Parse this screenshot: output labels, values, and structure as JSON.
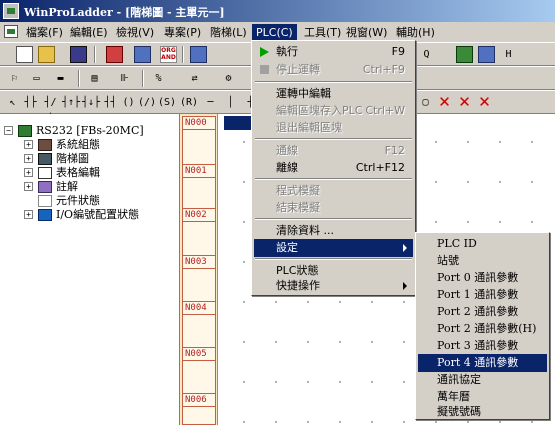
{
  "window": {
    "title": "WinProLadder - [階梯圖 - 主單元一]"
  },
  "menubar": {
    "items": [
      {
        "label": "檔案(F)"
      },
      {
        "label": "編輯(E)"
      },
      {
        "label": "檢視(V)"
      },
      {
        "label": "專案(P)"
      },
      {
        "label": "階梯(L)"
      },
      {
        "label": "PLC(C)"
      },
      {
        "label": "工具(T)"
      },
      {
        "label": "視窗(W)"
      },
      {
        "label": "輔助(H)"
      }
    ]
  },
  "toolbar": {
    "orand_label": "ORG AND"
  },
  "tree": {
    "root": {
      "label": "RS232 [FBs-20MC]"
    },
    "items": [
      {
        "label": "系統組態"
      },
      {
        "label": "階梯圖"
      },
      {
        "label": "表格編輯"
      },
      {
        "label": "註解"
      },
      {
        "label": "元件狀態"
      },
      {
        "label": "I/O編號配置狀態"
      }
    ]
  },
  "ladder": {
    "networks": [
      "N000",
      "N001",
      "N002",
      "N003",
      "N004",
      "N005",
      "N006"
    ]
  },
  "plc_menu": {
    "items": [
      {
        "label": "執行",
        "shortcut": "F9"
      },
      {
        "label": "停止運轉",
        "shortcut": "Ctrl+F9"
      },
      {
        "label": "運轉中編輯",
        "shortcut": ""
      },
      {
        "label": "編輯區塊存入PLC",
        "shortcut": "Ctrl+W"
      },
      {
        "label": "退出編輯區塊",
        "shortcut": ""
      },
      {
        "label": "通線",
        "shortcut": "F12"
      },
      {
        "label": "離線",
        "shortcut": "Ctrl+F12"
      },
      {
        "label": "程式模擬",
        "shortcut": ""
      },
      {
        "label": "結束模擬",
        "shortcut": ""
      },
      {
        "label": "清除資料 ...",
        "shortcut": ""
      },
      {
        "label": "設定",
        "shortcut": ""
      },
      {
        "label": "PLC狀態",
        "shortcut": ""
      },
      {
        "label": "快捷操作",
        "shortcut": ""
      }
    ]
  },
  "settings_submenu": {
    "items": [
      {
        "label": "PLC ID"
      },
      {
        "label": "站號"
      },
      {
        "label": "Port 0 通訊參數"
      },
      {
        "label": "Port 1 通訊參數"
      },
      {
        "label": "Port 2 通訊參數"
      },
      {
        "label": "Port 2 通訊參數(H)"
      },
      {
        "label": "Port 3 通訊參數"
      },
      {
        "label": "Port 4 通訊參數"
      },
      {
        "label": "通訊協定"
      },
      {
        "label": "萬年曆"
      },
      {
        "label": "擬號號碼"
      }
    ]
  },
  "colors": {
    "highlight": "#0a246a",
    "face": "#d4d0c8",
    "network_label": "#b22222"
  }
}
